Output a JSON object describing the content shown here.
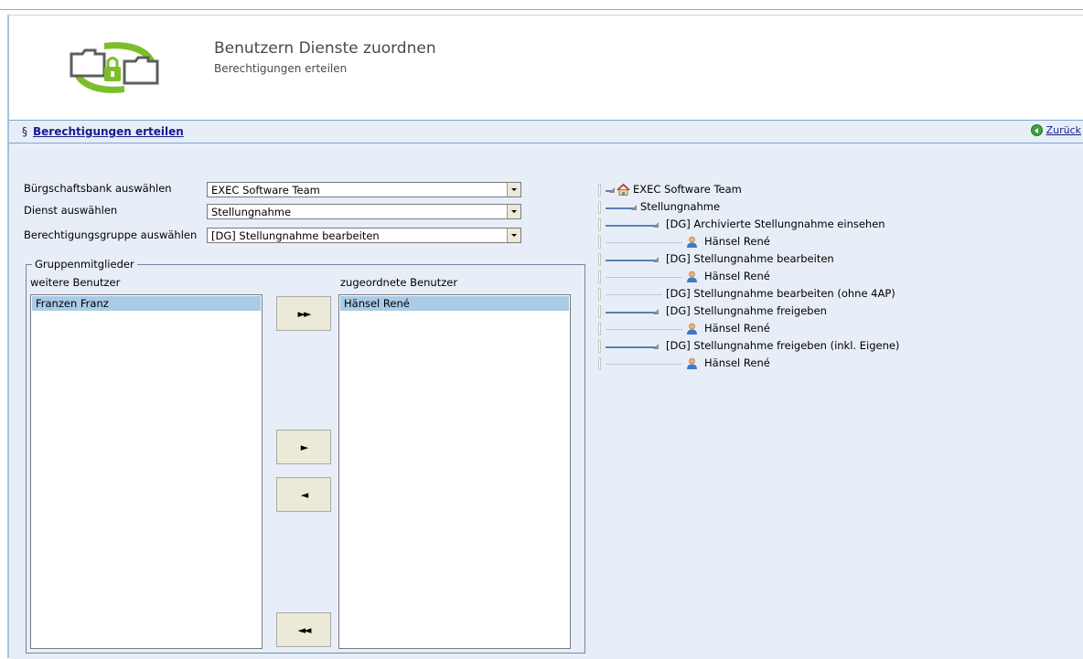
{
  "header": {
    "title": "Benutzern Dienste zuordnen",
    "subtitle": "Berechtigungen erteilen"
  },
  "nav": {
    "section_symbol": "§",
    "link_label": "Berechtigungen erteilen",
    "back_label": "Zurück"
  },
  "form": {
    "bank_label": "Bürgschaftsbank auswählen",
    "bank_value": "EXEC Software Team",
    "service_label": "Dienst auswählen",
    "service_value": "Stellungnahme",
    "group_label": "Berechtigungsgruppe auswählen",
    "group_value": "[DG] Stellungnahme bearbeiten"
  },
  "members": {
    "legend": "Gruppenmitglieder",
    "available_label": "weitere Benutzer",
    "assigned_label": "zugeordnete Benutzer",
    "available": [
      "Franzen Franz"
    ],
    "assigned": [
      "Hänsel René"
    ],
    "buttons": {
      "add_all": "►►",
      "add": "►",
      "remove": "◄",
      "remove_all": "◄◄"
    }
  },
  "tree": {
    "root": "EXEC Software Team",
    "service": "Stellungnahme",
    "group1": "[DG] Archivierte Stellungnahme einsehen",
    "group1_user": "Hänsel René",
    "group2": "[DG] Stellungnahme bearbeiten",
    "group2_user": "Hänsel René",
    "group3": "[DG] Stellungnahme bearbeiten (ohne 4AP)",
    "group4": "[DG] Stellungnahme freigeben",
    "group4_user": "Hänsel René",
    "group5": "[DG] Stellungnahme freigeben (inkl. Eigene)",
    "group5_user": "Hänsel René"
  },
  "icons": {
    "logo": "folder-lock-folder-logo",
    "back": "green-back-arrow-icon",
    "user": "user-icon",
    "home": "home-icon"
  },
  "colors": {
    "content_bg": "#e8eef8",
    "selected_item": "#a9cbe6",
    "logo_green": "#7cbe2a",
    "link": "#1a1a8c"
  }
}
